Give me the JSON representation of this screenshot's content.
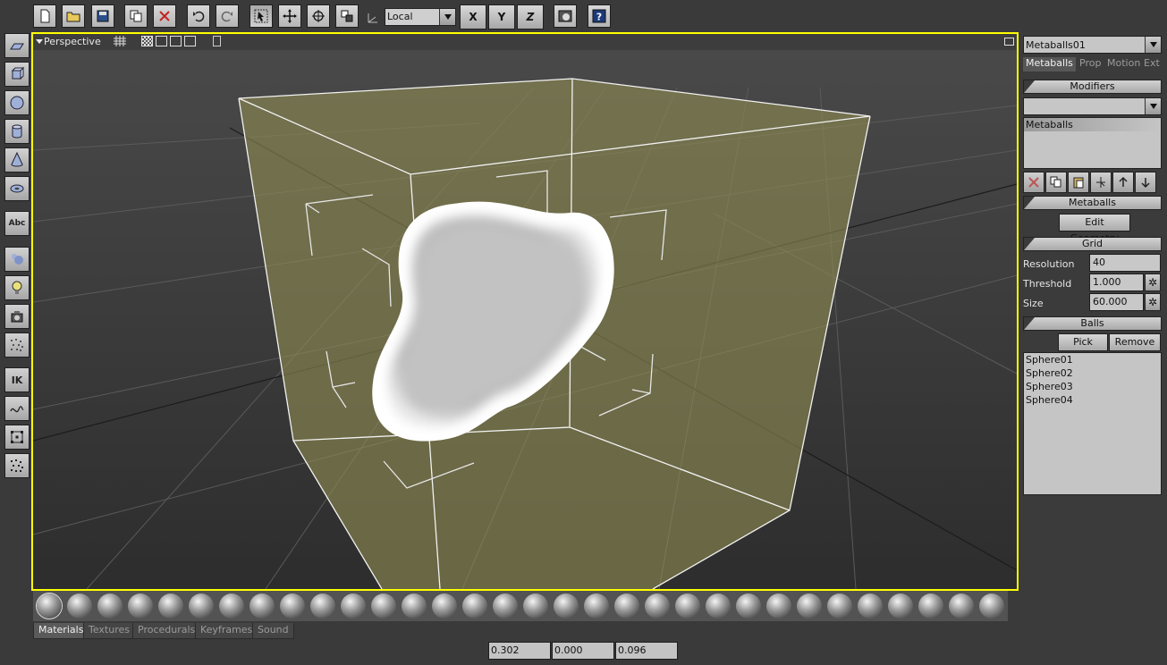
{
  "toolbar": {
    "coord_system": "Local",
    "axis_x": "X",
    "axis_y": "Y",
    "axis_z": "Z"
  },
  "left_toolbar": {
    "text_tool": "Abc",
    "ik_tool": "IK"
  },
  "viewport": {
    "title": "Perspective"
  },
  "material_tabs": [
    "Materials",
    "Textures",
    "Procedurals",
    "Keyframes",
    "Sound"
  ],
  "coords": [
    "0.302",
    "0.000",
    "0.096"
  ],
  "panel": {
    "object_name": "Metaballs01",
    "tabs": [
      "Metaballs",
      "Prop",
      "Motion",
      "Ext"
    ],
    "modifiers_header": "Modifiers",
    "modifier_stack": [
      "Metaballs"
    ],
    "metaballs_header": "Metaballs",
    "edit_geometry": "Edit Geometry",
    "grid_header": "Grid",
    "resolution_label": "Resolution",
    "resolution_value": "40",
    "threshold_label": "Threshold",
    "threshold_value": "1.000",
    "size_label": "Size",
    "size_value": "60.000",
    "balls_header": "Balls",
    "pick_label": "Pick",
    "remove_label": "Remove",
    "balls": [
      "Sphere01",
      "Sphere02",
      "Sphere03",
      "Sphere04"
    ]
  },
  "colors": {
    "viewport_border": "#ffff00",
    "grid_volume": "#8e8a52",
    "panel_bg": "#3b3b3b"
  }
}
